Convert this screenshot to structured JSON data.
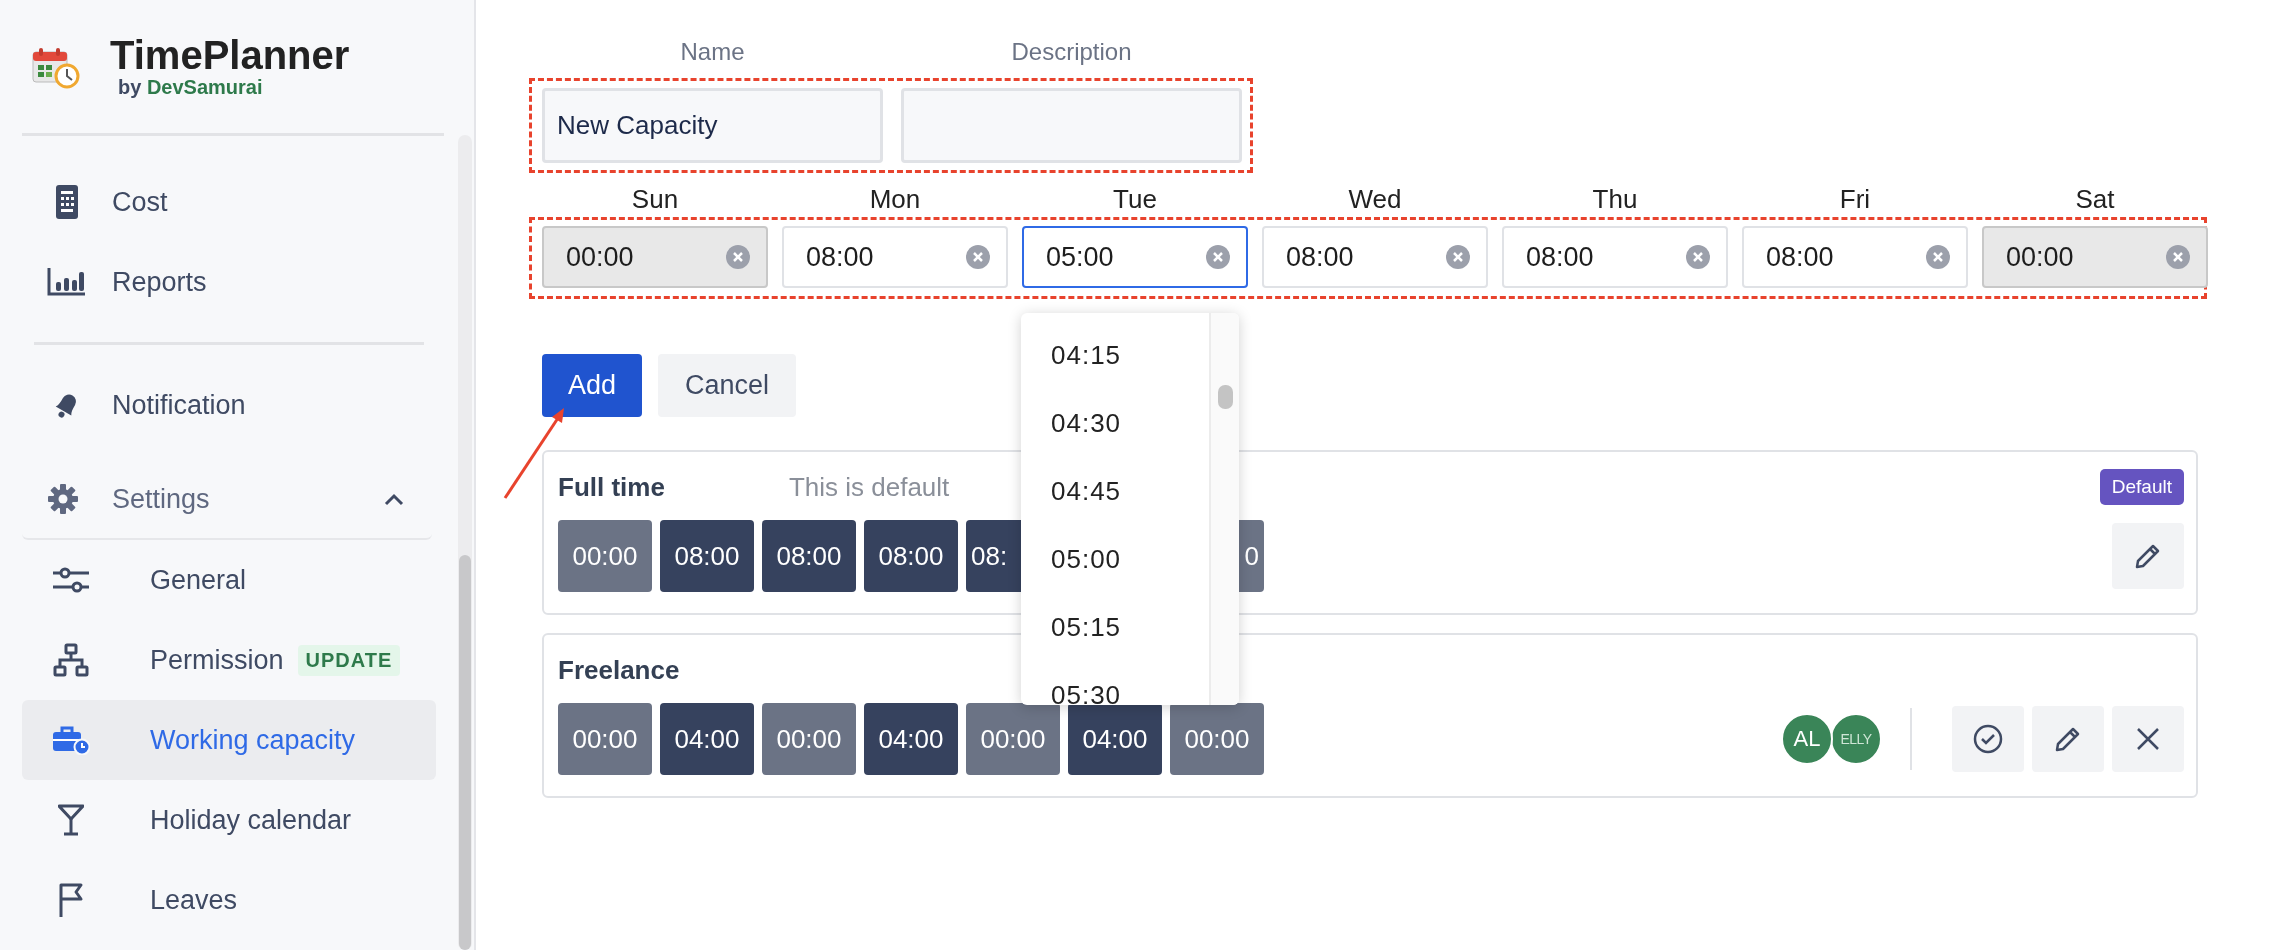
{
  "sidebar": {
    "app_title": "TimePlanner",
    "byline_prefix": "by",
    "byline_brand": "DevSamurai",
    "top_items": [
      {
        "label": "Cost",
        "selected": false
      },
      {
        "label": "Reports",
        "selected": false
      }
    ],
    "items": [
      {
        "label": "Notification",
        "selected": false
      }
    ],
    "settings": {
      "label": "Settings",
      "expanded": true,
      "children": [
        {
          "label": "General",
          "selected": false
        },
        {
          "label": "Permission",
          "badge": "UPDATE",
          "selected": false
        },
        {
          "label": "Working capacity",
          "selected": true
        },
        {
          "label": "Holiday calendar",
          "selected": false
        },
        {
          "label": "Leaves",
          "selected": false
        }
      ]
    }
  },
  "form": {
    "name_label": "Name",
    "name_value": "New Capacity",
    "description_label": "Description",
    "days": [
      {
        "label": "Sun",
        "value": "00:00",
        "disabled": true,
        "focused": false
      },
      {
        "label": "Mon",
        "value": "08:00",
        "disabled": false,
        "focused": false
      },
      {
        "label": "Tue",
        "value": "05:00",
        "disabled": false,
        "focused": true
      },
      {
        "label": "Wed",
        "value": "08:00",
        "disabled": false,
        "focused": false
      },
      {
        "label": "Thu",
        "value": "08:00",
        "disabled": false,
        "focused": false
      },
      {
        "label": "Fri",
        "value": "08:00",
        "disabled": false,
        "focused": false
      },
      {
        "label": "Sat",
        "value": "00:00",
        "disabled": true,
        "focused": false
      }
    ],
    "time_dropdown": {
      "options": [
        "04:15",
        "04:30",
        "04:45",
        "05:00",
        "05:15",
        "05:30"
      ]
    },
    "add_button": "Add",
    "cancel_button": "Cancel"
  },
  "capacities": [
    {
      "name": "Full time",
      "note": "This is default",
      "badge": "Default",
      "chips": [
        {
          "value": "00:00",
          "off": true
        },
        {
          "value": "08:00",
          "off": false
        },
        {
          "value": "08:00",
          "off": false
        },
        {
          "value": "08:00",
          "off": false
        },
        {
          "value": "08:",
          "off": false
        },
        {
          "value": "0",
          "off": true
        }
      ],
      "actions": [
        {
          "kind": "edit"
        }
      ]
    },
    {
      "name": "Freelance",
      "chips": [
        {
          "value": "00:00",
          "off": true
        },
        {
          "value": "04:00",
          "off": false
        },
        {
          "value": "00:00",
          "off": true
        },
        {
          "value": "04:00",
          "off": false
        },
        {
          "value": "00:00",
          "off": true
        },
        {
          "value": "04:00",
          "off": false
        },
        {
          "value": "00:00",
          "off": true
        }
      ],
      "avatars": [
        {
          "initials": "AL"
        },
        {
          "initials": "ELLY"
        }
      ],
      "actions": [
        {
          "kind": "confirm"
        },
        {
          "kind": "edit"
        },
        {
          "kind": "delete"
        }
      ]
    }
  ]
}
